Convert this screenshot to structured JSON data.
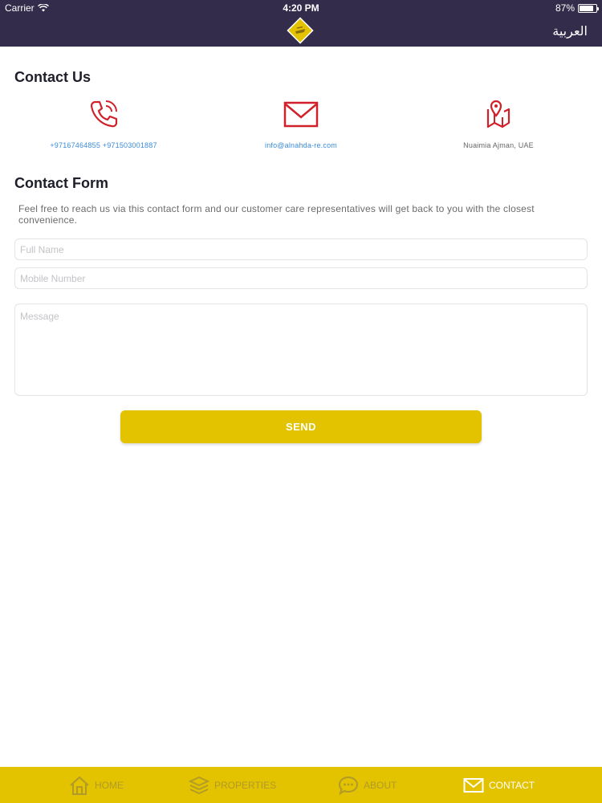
{
  "status_bar": {
    "carrier": "Carrier",
    "time": "4:20 PM",
    "battery": "87%",
    "battery_level": 0.87
  },
  "header": {
    "language_toggle": "العربية",
    "logo_icon": "diamond-logo-icon"
  },
  "contact_us": {
    "title": "Contact Us",
    "phone": {
      "icon": "phone-icon",
      "text": "+97167464855 +971503001887"
    },
    "email": {
      "icon": "mail-icon",
      "text": "info@alnahda-re.com"
    },
    "location": {
      "icon": "map-pin-icon",
      "text": "Nuaimia Ajman, UAE"
    }
  },
  "contact_form": {
    "title": "Contact Form",
    "description": "Feel free to reach us via this contact form and our customer care representatives will get back to you with the closest convenience.",
    "full_name": {
      "placeholder": "Full Name",
      "value": ""
    },
    "mobile_number": {
      "placeholder": "Mobile Number",
      "value": ""
    },
    "message": {
      "placeholder": "Message",
      "value": ""
    },
    "send_label": "SEND"
  },
  "tabs": [
    {
      "label": "HOME",
      "icon": "home-icon",
      "active": false
    },
    {
      "label": "PROPERTIES",
      "icon": "layers-icon",
      "active": false
    },
    {
      "label": "ABOUT",
      "icon": "chat-bubble-icon",
      "active": false
    },
    {
      "label": "CONTACT",
      "icon": "mail-icon",
      "active": true
    }
  ],
  "colors": {
    "header": "#332d4b",
    "accent": "#e3c200",
    "icon_red": "#d0202a",
    "link_blue": "#3a8bd9"
  }
}
